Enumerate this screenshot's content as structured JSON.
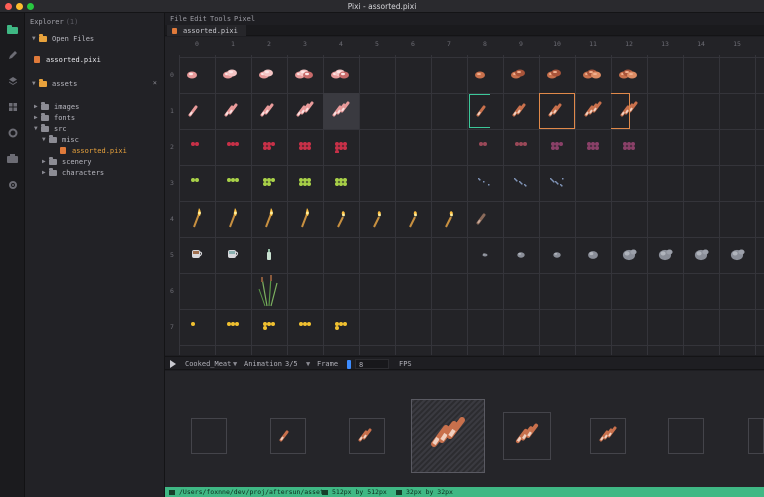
{
  "window": {
    "title": "Pixi - assorted.pixi"
  },
  "activity_bar": [
    "folder-icon",
    "pencil-icon",
    "layers-icon",
    "grid-icon",
    "settings-gear-icon",
    "export-icon",
    "gear-icon"
  ],
  "explorer": {
    "title": "Explorer",
    "count": "(1)",
    "open_files_label": "Open Files",
    "open_files": [
      "assorted.pixi"
    ],
    "assets_label": "assets",
    "close_symbol": "×",
    "tree": [
      {
        "label": "images",
        "depth": 1,
        "expanded": false
      },
      {
        "label": "fonts",
        "depth": 1,
        "expanded": false
      },
      {
        "label": "src",
        "depth": 1,
        "expanded": true
      },
      {
        "label": "misc",
        "depth": 2,
        "expanded": true
      },
      {
        "label": "assorted.pixi",
        "depth": 3,
        "file": true
      },
      {
        "label": "scenery",
        "depth": 2,
        "expanded": false
      },
      {
        "label": "characters",
        "depth": 2,
        "expanded": false
      }
    ]
  },
  "menu": [
    "File",
    "Edit",
    "Tools",
    "Pixel"
  ],
  "tab": {
    "label": "assorted.pixi"
  },
  "sheet": {
    "columns": [
      "0",
      "1",
      "2",
      "3",
      "4",
      "5",
      "6",
      "7",
      "8",
      "9",
      "10",
      "11",
      "12",
      "13",
      "14",
      "15"
    ],
    "rows": [
      "0",
      "1",
      "2",
      "3",
      "4",
      "5",
      "6",
      "7"
    ]
  },
  "animation_bar": {
    "name": "Cooked_Meat",
    "mode": "Animation",
    "frame_index": "3/5",
    "frame_label": "Frame",
    "value": "8",
    "fps_label": "FPS"
  },
  "status_bar": {
    "path": "/Users/foxnne/dev/proj/aftersun/assets",
    "canvas_size": "512px by 512px",
    "tile_size": "32px by 32px"
  },
  "colors": {
    "accent_green": "#3fb884",
    "accent_orange": "#e0894a",
    "folder": "#e8a23c"
  }
}
